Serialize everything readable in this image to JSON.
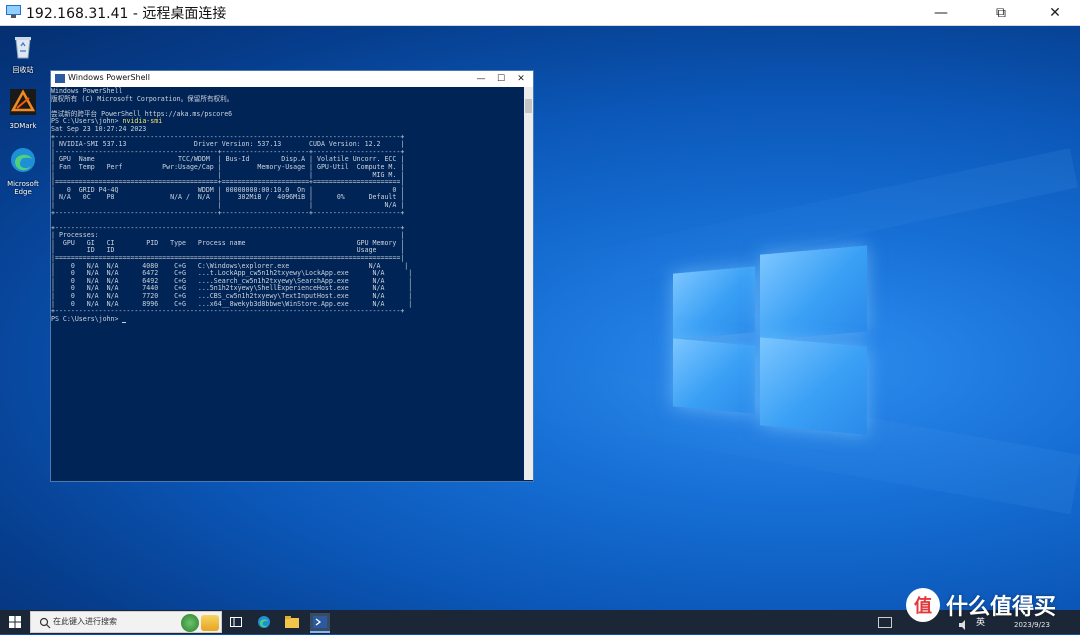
{
  "rdp": {
    "title": "192.168.31.41 - 远程桌面连接",
    "minimize_glyph": "—",
    "restore_glyph": "⧉",
    "close_glyph": "✕"
  },
  "desktop_icons": [
    {
      "label": "回收站",
      "icon": "recycle-bin-icon"
    },
    {
      "label": "3DMark",
      "icon": "3dmark-icon"
    },
    {
      "label": "Microsoft Edge",
      "icon": "edge-icon"
    }
  ],
  "powershell": {
    "title": "Windows PowerShell",
    "prompt": "PS C:\\Users\\john> ",
    "command": "nvidia-smi",
    "lines_before": [
      "Windows PowerShell",
      "版权所有 (C) Microsoft Corporation。保留所有权利。",
      "",
      "尝试新的跨平台 PowerShell https://aka.ms/pscore6",
      ""
    ],
    "output": [
      "Sat Sep 23 10:27:24 2023",
      "+---------------------------------------------------------------------------------------+",
      "| NVIDIA-SMI 537.13                 Driver Version: 537.13       CUDA Version: 12.2     |",
      "|-----------------------------------------+----------------------+----------------------+",
      "| GPU  Name                     TCC/WDDM  | Bus-Id        Disp.A | Volatile Uncorr. ECC |",
      "| Fan  Temp   Perf          Pwr:Usage/Cap |         Memory-Usage | GPU-Util  Compute M. |",
      "|                                         |                      |               MIG M. |",
      "|=========================================+======================+======================|",
      "|   0  GRID P4-4Q                    WDDM | 00000000:00:10.0  On |                    0 |",
      "| N/A   0C    P8              N/A /  N/A  |    302MiB /  4096MiB |      0%      Default |",
      "|                                         |                      |                  N/A |",
      "+-----------------------------------------+----------------------+----------------------+",
      "",
      "+---------------------------------------------------------------------------------------+",
      "| Processes:                                                                            |",
      "|  GPU   GI   CI        PID   Type   Process name                            GPU Memory |",
      "|        ID   ID                                                             Usage      |",
      "|=======================================================================================|",
      "|    0   N/A  N/A      4080    C+G   C:\\Windows\\explorer.exe                    N/A      |",
      "|    0   N/A  N/A      6472    C+G   ...t.LockApp_cw5n1h2txyewy\\LockApp.exe      N/A      |",
      "|    0   N/A  N/A      6492    C+G   ....Search_cw5n1h2txyewy\\SearchApp.exe      N/A      |",
      "|    0   N/A  N/A      7440    C+G   ...5n1h2txyewy\\ShellExperienceHost.exe      N/A      |",
      "|    0   N/A  N/A      7720    C+G   ...CBS_cw5n1h2txyewy\\TextInputHost.exe      N/A      |",
      "|    0   N/A  N/A      8996    C+G   ...x64__8wekyb3d8bbwe\\WinStore.App.exe      N/A      |",
      "+---------------------------------------------------------------------------------------+"
    ],
    "final_prompt": "PS C:\\Users\\john> "
  },
  "taskbar": {
    "search_placeholder": "在此键入进行搜索",
    "apps": [
      "task-view-icon",
      "edge-icon",
      "file-explorer-icon",
      "powershell-icon"
    ],
    "lang": "英",
    "date": "2023/9/23"
  },
  "watermark": {
    "glyph": "值",
    "text": "什么值得买"
  },
  "colors": {
    "ps_background": "#012456",
    "ps_text": "#ccd3dd",
    "command_highlight": "#f4e46c",
    "taskbar": "#1b2636"
  }
}
